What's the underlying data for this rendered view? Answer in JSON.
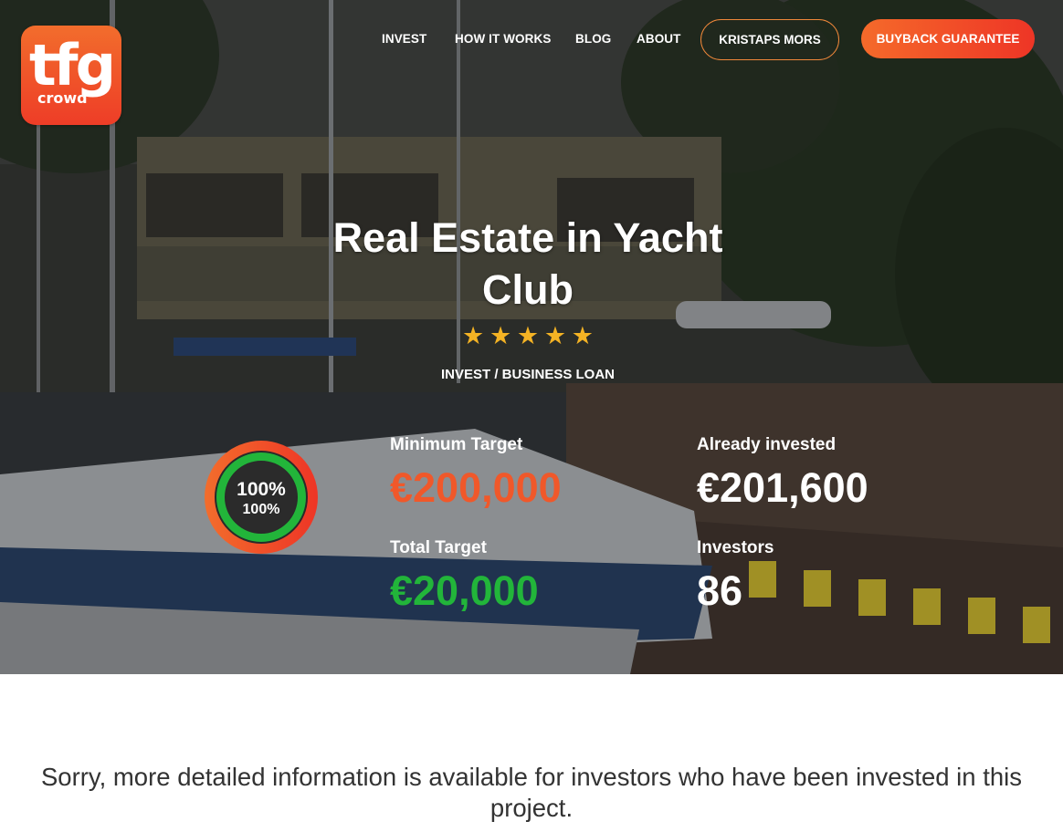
{
  "brand": {
    "logo_main": "tfg",
    "logo_sub": "crowd",
    "accent": "#f26d2c",
    "accent_dark": "#ee3526"
  },
  "nav": {
    "links": [
      "INVEST",
      "HOW IT WORKS",
      "BLOG",
      "ABOUT"
    ],
    "user_button": "KRISTAPS MORS",
    "cta_button": "BUYBACK GUARANTEE"
  },
  "project": {
    "title": "Real Estate in Yacht Club",
    "rating": 5,
    "category": "INVEST / BUSINESS LOAN",
    "progress_percent": "100%",
    "progress_sub": "100%",
    "progress_fraction": 1.0
  },
  "stats": {
    "min_target_label": "Minimum Target",
    "min_target_value": "€200,000",
    "total_target_label": "Total Target",
    "total_target_value": "€20,000",
    "invested_label": "Already invested",
    "invested_value": "€201,600",
    "investors_label": "Investors",
    "investors_value": "86"
  },
  "notice": "Sorry, more detailed information is available for investors who have been invested in this project.",
  "colors": {
    "orange_value": "#f0582a",
    "green_value": "#22b53a",
    "star": "#f4b324"
  }
}
